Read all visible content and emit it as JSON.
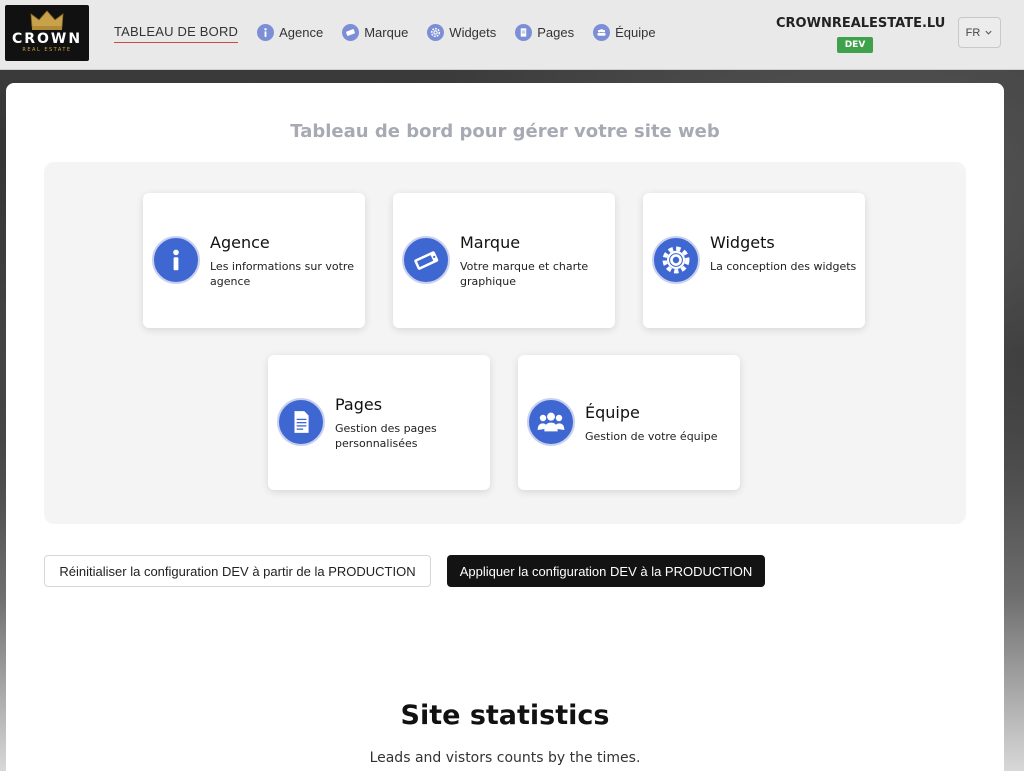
{
  "brand": {
    "logo_word": "CROWN",
    "logo_sub": "REAL ESTATE",
    "colors": {
      "accent_gold": "#c8a24a",
      "logo_bg": "#111111"
    }
  },
  "nav": {
    "items": [
      {
        "label": "TABLEAU DE BORD",
        "icon": null,
        "active": true
      },
      {
        "label": "Agence",
        "icon": "info-icon"
      },
      {
        "label": "Marque",
        "icon": "brand-tag-icon"
      },
      {
        "label": "Widgets",
        "icon": "gear-icon"
      },
      {
        "label": "Pages",
        "icon": "document-icon"
      },
      {
        "label": "Équipe",
        "icon": "team-icon"
      }
    ]
  },
  "site": {
    "name": "CROWNREALESTATE.LU",
    "env": "DEV",
    "env_color": "#3fa14b"
  },
  "lang": {
    "value": "FR"
  },
  "dashboard": {
    "title": "Tableau de bord pour gérer votre site web",
    "cards": [
      {
        "title": "Agence",
        "desc": "Les informations sur votre agence",
        "icon": "info-icon"
      },
      {
        "title": "Marque",
        "desc": "Votre marque et charte graphique",
        "icon": "brand-tag-icon"
      },
      {
        "title": "Widgets",
        "desc": "La conception des widgets",
        "icon": "gear-icon"
      },
      {
        "title": "Pages",
        "desc": "Gestion des pages personnalisées",
        "icon": "document-icon"
      },
      {
        "title": "Équipe",
        "desc": "Gestion de votre équipe",
        "icon": "team-icon"
      }
    ],
    "icon_color": "#3f67d1"
  },
  "actions": {
    "reset_label": "Réinitialiser la configuration DEV à partir de la PRODUCTION",
    "apply_label": "Appliquer la configuration DEV à la PRODUCTION"
  },
  "stats": {
    "title": "Site statistics",
    "subtitle": "Leads and vistors counts by the times."
  }
}
